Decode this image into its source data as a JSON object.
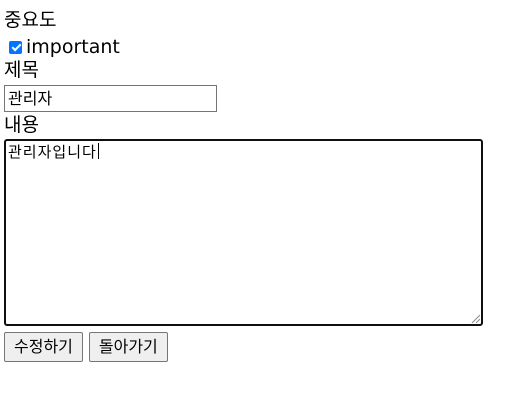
{
  "form": {
    "importance_label": "중요도",
    "important_checkbox_label": "important",
    "important_checked": true,
    "title_label": "제목",
    "title_value": "관리자",
    "content_label": "내용",
    "content_value": "관리자입니다"
  },
  "buttons": {
    "edit_label": "수정하기",
    "back_label": "돌아가기"
  },
  "colors": {
    "checkbox_accent": "#0075ff",
    "button_bg": "#efefef"
  }
}
